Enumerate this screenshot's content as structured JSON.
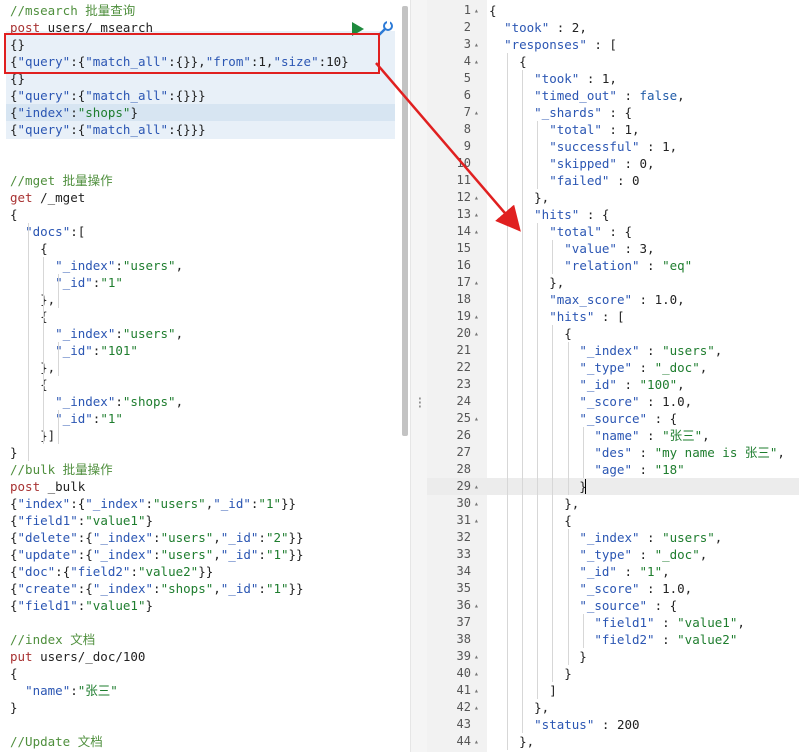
{
  "colors": {
    "comment": "#4f8f3d",
    "method": "#a83232",
    "key": "#2b56b3",
    "string": "#1e7d2e",
    "keyword": "#1f5ba8",
    "highlight": "#e8f0f8",
    "annotation_red": "#e02020",
    "run_green": "#1e8a3d"
  },
  "icons": {
    "run": "play-icon",
    "settings": "wrench-icon",
    "resize": "drag-handle-icon"
  },
  "left_lines": [
    [
      [
        "c-comment",
        "//msearch 批量查询"
      ]
    ],
    [
      [
        "c-method",
        "post"
      ],
      [
        "c-plain",
        " users/ msearch"
      ]
    ],
    [
      [
        "c-plain",
        "{}"
      ]
    ],
    [
      [
        "c-plain",
        "{"
      ],
      [
        "c-key",
        "\"query\""
      ],
      [
        "c-plain",
        ":{"
      ],
      [
        "c-key",
        "\"match_all\""
      ],
      [
        "c-plain",
        ":{}},"
      ],
      [
        "c-key",
        "\"from\""
      ],
      [
        "c-plain",
        ":1,"
      ],
      [
        "c-key",
        "\"size\""
      ],
      [
        "c-plain",
        ":10}"
      ]
    ],
    [
      [
        "c-plain",
        "{}"
      ]
    ],
    [
      [
        "c-plain",
        "{"
      ],
      [
        "c-key",
        "\"query\""
      ],
      [
        "c-plain",
        ":{"
      ],
      [
        "c-key",
        "\"match_all\""
      ],
      [
        "c-plain",
        ":{}}}"
      ]
    ],
    [
      [
        "c-plain",
        "{"
      ],
      [
        "c-key",
        "\"index\""
      ],
      [
        "c-plain",
        ":"
      ],
      [
        "c-str",
        "\"shops\""
      ],
      [
        "c-plain",
        "}"
      ]
    ],
    [
      [
        "c-plain",
        "{"
      ],
      [
        "c-key",
        "\"query\""
      ],
      [
        "c-plain",
        ":{"
      ],
      [
        "c-key",
        "\"match_all\""
      ],
      [
        "c-plain",
        ":{}}}"
      ]
    ],
    [],
    [],
    [
      [
        "c-comment",
        "//mget 批量操作"
      ]
    ],
    [
      [
        "c-method",
        "get"
      ],
      [
        "c-plain",
        " /_mget"
      ]
    ],
    [
      [
        "c-plain",
        "{"
      ]
    ],
    [
      [
        "c-plain",
        "  "
      ],
      [
        "c-key",
        "\"docs\""
      ],
      [
        "c-plain",
        ":["
      ]
    ],
    [
      [
        "c-plain",
        "    {"
      ]
    ],
    [
      [
        "c-plain",
        "      "
      ],
      [
        "c-key",
        "\"_index\""
      ],
      [
        "c-plain",
        ":"
      ],
      [
        "c-str",
        "\"users\""
      ],
      [
        "c-plain",
        ","
      ]
    ],
    [
      [
        "c-plain",
        "      "
      ],
      [
        "c-key",
        "\"_id\""
      ],
      [
        "c-plain",
        ":"
      ],
      [
        "c-str",
        "\"1\""
      ]
    ],
    [
      [
        "c-plain",
        "    },"
      ]
    ],
    [
      [
        "c-plain",
        "    {"
      ]
    ],
    [
      [
        "c-plain",
        "      "
      ],
      [
        "c-key",
        "\"_index\""
      ],
      [
        "c-plain",
        ":"
      ],
      [
        "c-str",
        "\"users\""
      ],
      [
        "c-plain",
        ","
      ]
    ],
    [
      [
        "c-plain",
        "      "
      ],
      [
        "c-key",
        "\"_id\""
      ],
      [
        "c-plain",
        ":"
      ],
      [
        "c-str",
        "\"101\""
      ]
    ],
    [
      [
        "c-plain",
        "    },"
      ]
    ],
    [
      [
        "c-plain",
        "    {"
      ]
    ],
    [
      [
        "c-plain",
        "      "
      ],
      [
        "c-key",
        "\"_index\""
      ],
      [
        "c-plain",
        ":"
      ],
      [
        "c-str",
        "\"shops\""
      ],
      [
        "c-plain",
        ","
      ]
    ],
    [
      [
        "c-plain",
        "      "
      ],
      [
        "c-key",
        "\"_id\""
      ],
      [
        "c-plain",
        ":"
      ],
      [
        "c-str",
        "\"1\""
      ]
    ],
    [
      [
        "c-plain",
        "    }]"
      ]
    ],
    [
      [
        "c-plain",
        "}"
      ]
    ],
    [
      [
        "c-comment",
        "//bulk 批量操作"
      ]
    ],
    [
      [
        "c-method",
        "post"
      ],
      [
        "c-plain",
        " _bulk"
      ]
    ],
    [
      [
        "c-plain",
        "{"
      ],
      [
        "c-key",
        "\"index\""
      ],
      [
        "c-plain",
        ":{"
      ],
      [
        "c-key",
        "\"_index\""
      ],
      [
        "c-plain",
        ":"
      ],
      [
        "c-str",
        "\"users\""
      ],
      [
        "c-plain",
        ","
      ],
      [
        "c-key",
        "\"_id\""
      ],
      [
        "c-plain",
        ":"
      ],
      [
        "c-str",
        "\"1\""
      ],
      [
        "c-plain",
        "}}"
      ]
    ],
    [
      [
        "c-plain",
        "{"
      ],
      [
        "c-key",
        "\"field1\""
      ],
      [
        "c-plain",
        ":"
      ],
      [
        "c-str",
        "\"value1\""
      ],
      [
        "c-plain",
        "}"
      ]
    ],
    [
      [
        "c-plain",
        "{"
      ],
      [
        "c-key",
        "\"delete\""
      ],
      [
        "c-plain",
        ":{"
      ],
      [
        "c-key",
        "\"_index\""
      ],
      [
        "c-plain",
        ":"
      ],
      [
        "c-str",
        "\"users\""
      ],
      [
        "c-plain",
        ","
      ],
      [
        "c-key",
        "\"_id\""
      ],
      [
        "c-plain",
        ":"
      ],
      [
        "c-str",
        "\"2\""
      ],
      [
        "c-plain",
        "}}"
      ]
    ],
    [
      [
        "c-plain",
        "{"
      ],
      [
        "c-key",
        "\"update\""
      ],
      [
        "c-plain",
        ":{"
      ],
      [
        "c-key",
        "\"_index\""
      ],
      [
        "c-plain",
        ":"
      ],
      [
        "c-str",
        "\"users\""
      ],
      [
        "c-plain",
        ","
      ],
      [
        "c-key",
        "\"_id\""
      ],
      [
        "c-plain",
        ":"
      ],
      [
        "c-str",
        "\"1\""
      ],
      [
        "c-plain",
        "}}"
      ]
    ],
    [
      [
        "c-plain",
        "{"
      ],
      [
        "c-key",
        "\"doc\""
      ],
      [
        "c-plain",
        ":{"
      ],
      [
        "c-key",
        "\"field2\""
      ],
      [
        "c-plain",
        ":"
      ],
      [
        "c-str",
        "\"value2\""
      ],
      [
        "c-plain",
        "}}"
      ]
    ],
    [
      [
        "c-plain",
        "{"
      ],
      [
        "c-key",
        "\"create\""
      ],
      [
        "c-plain",
        ":{"
      ],
      [
        "c-key",
        "\"_index\""
      ],
      [
        "c-plain",
        ":"
      ],
      [
        "c-str",
        "\"shops\""
      ],
      [
        "c-plain",
        ","
      ],
      [
        "c-key",
        "\"_id\""
      ],
      [
        "c-plain",
        ":"
      ],
      [
        "c-str",
        "\"1\""
      ],
      [
        "c-plain",
        "}}"
      ]
    ],
    [
      [
        "c-plain",
        "{"
      ],
      [
        "c-key",
        "\"field1\""
      ],
      [
        "c-plain",
        ":"
      ],
      [
        "c-str",
        "\"value1\""
      ],
      [
        "c-plain",
        "}"
      ]
    ],
    [],
    [
      [
        "c-comment",
        "//index 文档"
      ]
    ],
    [
      [
        "c-method",
        "put"
      ],
      [
        "c-plain",
        " users/_doc/100"
      ]
    ],
    [
      [
        "c-plain",
        "{"
      ]
    ],
    [
      [
        "c-plain",
        "  "
      ],
      [
        "c-key",
        "\"name\""
      ],
      [
        "c-plain",
        ":"
      ],
      [
        "c-str",
        "\"张三\""
      ]
    ],
    [
      [
        "c-plain",
        "}"
      ]
    ],
    [],
    [
      [
        "c-comment",
        "//Update 文档"
      ]
    ]
  ],
  "right_lines": [
    {
      "n": "1",
      "fold": true,
      "t": [
        [
          "c-plain",
          "{"
        ]
      ]
    },
    {
      "n": "2",
      "fold": false,
      "t": [
        [
          "c-plain",
          "  "
        ],
        [
          "c-key",
          "\"took\""
        ],
        [
          "c-plain",
          " : 2,"
        ]
      ]
    },
    {
      "n": "3",
      "fold": true,
      "t": [
        [
          "c-plain",
          "  "
        ],
        [
          "c-key",
          "\"responses\""
        ],
        [
          "c-plain",
          " : ["
        ]
      ]
    },
    {
      "n": "4",
      "fold": true,
      "t": [
        [
          "c-plain",
          "    {"
        ]
      ]
    },
    {
      "n": "5",
      "fold": false,
      "t": [
        [
          "c-plain",
          "      "
        ],
        [
          "c-key",
          "\"took\""
        ],
        [
          "c-plain",
          " : 1,"
        ]
      ]
    },
    {
      "n": "6",
      "fold": false,
      "t": [
        [
          "c-plain",
          "      "
        ],
        [
          "c-key",
          "\"timed_out\""
        ],
        [
          "c-plain",
          " : "
        ],
        [
          "c-kw",
          "false"
        ],
        [
          "c-plain",
          ","
        ]
      ]
    },
    {
      "n": "7",
      "fold": true,
      "t": [
        [
          "c-plain",
          "      "
        ],
        [
          "c-key",
          "\"_shards\""
        ],
        [
          "c-plain",
          " : {"
        ]
      ]
    },
    {
      "n": "8",
      "fold": false,
      "t": [
        [
          "c-plain",
          "        "
        ],
        [
          "c-key",
          "\"total\""
        ],
        [
          "c-plain",
          " : 1,"
        ]
      ]
    },
    {
      "n": "9",
      "fold": false,
      "t": [
        [
          "c-plain",
          "        "
        ],
        [
          "c-key",
          "\"successful\""
        ],
        [
          "c-plain",
          " : 1,"
        ]
      ]
    },
    {
      "n": "10",
      "fold": false,
      "t": [
        [
          "c-plain",
          "        "
        ],
        [
          "c-key",
          "\"skipped\""
        ],
        [
          "c-plain",
          " : 0,"
        ]
      ]
    },
    {
      "n": "11",
      "fold": false,
      "t": [
        [
          "c-plain",
          "        "
        ],
        [
          "c-key",
          "\"failed\""
        ],
        [
          "c-plain",
          " : 0"
        ]
      ]
    },
    {
      "n": "12",
      "fold": true,
      "t": [
        [
          "c-plain",
          "      },"
        ]
      ]
    },
    {
      "n": "13",
      "fold": true,
      "t": [
        [
          "c-plain",
          "      "
        ],
        [
          "c-key",
          "\"hits\""
        ],
        [
          "c-plain",
          " : {"
        ]
      ]
    },
    {
      "n": "14",
      "fold": true,
      "t": [
        [
          "c-plain",
          "        "
        ],
        [
          "c-key",
          "\"total\""
        ],
        [
          "c-plain",
          " : {"
        ]
      ]
    },
    {
      "n": "15",
      "fold": false,
      "t": [
        [
          "c-plain",
          "          "
        ],
        [
          "c-key",
          "\"value\""
        ],
        [
          "c-plain",
          " : 3,"
        ]
      ]
    },
    {
      "n": "16",
      "fold": false,
      "t": [
        [
          "c-plain",
          "          "
        ],
        [
          "c-key",
          "\"relation\""
        ],
        [
          "c-plain",
          " : "
        ],
        [
          "c-str",
          "\"eq\""
        ]
      ]
    },
    {
      "n": "17",
      "fold": true,
      "t": [
        [
          "c-plain",
          "        },"
        ]
      ]
    },
    {
      "n": "18",
      "fold": false,
      "t": [
        [
          "c-plain",
          "        "
        ],
        [
          "c-key",
          "\"max_score\""
        ],
        [
          "c-plain",
          " : 1.0,"
        ]
      ]
    },
    {
      "n": "19",
      "fold": true,
      "t": [
        [
          "c-plain",
          "        "
        ],
        [
          "c-key",
          "\"hits\""
        ],
        [
          "c-plain",
          " : ["
        ]
      ]
    },
    {
      "n": "20",
      "fold": true,
      "t": [
        [
          "c-plain",
          "          {"
        ]
      ]
    },
    {
      "n": "21",
      "fold": false,
      "t": [
        [
          "c-plain",
          "            "
        ],
        [
          "c-key",
          "\"_index\""
        ],
        [
          "c-plain",
          " : "
        ],
        [
          "c-str",
          "\"users\""
        ],
        [
          "c-plain",
          ","
        ]
      ]
    },
    {
      "n": "22",
      "fold": false,
      "t": [
        [
          "c-plain",
          "            "
        ],
        [
          "c-key",
          "\"_type\""
        ],
        [
          "c-plain",
          " : "
        ],
        [
          "c-str",
          "\"_doc\""
        ],
        [
          "c-plain",
          ","
        ]
      ]
    },
    {
      "n": "23",
      "fold": false,
      "t": [
        [
          "c-plain",
          "            "
        ],
        [
          "c-key",
          "\"_id\""
        ],
        [
          "c-plain",
          " : "
        ],
        [
          "c-str",
          "\"100\""
        ],
        [
          "c-plain",
          ","
        ]
      ]
    },
    {
      "n": "24",
      "fold": false,
      "t": [
        [
          "c-plain",
          "            "
        ],
        [
          "c-key",
          "\"_score\""
        ],
        [
          "c-plain",
          " : 1.0,"
        ]
      ]
    },
    {
      "n": "25",
      "fold": true,
      "t": [
        [
          "c-plain",
          "            "
        ],
        [
          "c-key",
          "\"_source\""
        ],
        [
          "c-plain",
          " : {"
        ]
      ]
    },
    {
      "n": "26",
      "fold": false,
      "t": [
        [
          "c-plain",
          "              "
        ],
        [
          "c-key",
          "\"name\""
        ],
        [
          "c-plain",
          " : "
        ],
        [
          "c-str",
          "\"张三\""
        ],
        [
          "c-plain",
          ","
        ]
      ]
    },
    {
      "n": "27",
      "fold": false,
      "t": [
        [
          "c-plain",
          "              "
        ],
        [
          "c-key",
          "\"des\""
        ],
        [
          "c-plain",
          " : "
        ],
        [
          "c-str",
          "\"my name is 张三\""
        ],
        [
          "c-plain",
          ","
        ]
      ]
    },
    {
      "n": "28",
      "fold": false,
      "t": [
        [
          "c-plain",
          "              "
        ],
        [
          "c-key",
          "\"age\""
        ],
        [
          "c-plain",
          " : "
        ],
        [
          "c-str",
          "\"18\""
        ]
      ]
    },
    {
      "n": "29",
      "fold": true,
      "t": [
        [
          "c-plain",
          "            }"
        ]
      ]
    },
    {
      "n": "30",
      "fold": true,
      "t": [
        [
          "c-plain",
          "          },"
        ]
      ]
    },
    {
      "n": "31",
      "fold": true,
      "t": [
        [
          "c-plain",
          "          {"
        ]
      ]
    },
    {
      "n": "32",
      "fold": false,
      "t": [
        [
          "c-plain",
          "            "
        ],
        [
          "c-key",
          "\"_index\""
        ],
        [
          "c-plain",
          " : "
        ],
        [
          "c-str",
          "\"users\""
        ],
        [
          "c-plain",
          ","
        ]
      ]
    },
    {
      "n": "33",
      "fold": false,
      "t": [
        [
          "c-plain",
          "            "
        ],
        [
          "c-key",
          "\"_type\""
        ],
        [
          "c-plain",
          " : "
        ],
        [
          "c-str",
          "\"_doc\""
        ],
        [
          "c-plain",
          ","
        ]
      ]
    },
    {
      "n": "34",
      "fold": false,
      "t": [
        [
          "c-plain",
          "            "
        ],
        [
          "c-key",
          "\"_id\""
        ],
        [
          "c-plain",
          " : "
        ],
        [
          "c-str",
          "\"1\""
        ],
        [
          "c-plain",
          ","
        ]
      ]
    },
    {
      "n": "35",
      "fold": false,
      "t": [
        [
          "c-plain",
          "            "
        ],
        [
          "c-key",
          "\"_score\""
        ],
        [
          "c-plain",
          " : 1.0,"
        ]
      ]
    },
    {
      "n": "36",
      "fold": true,
      "t": [
        [
          "c-plain",
          "            "
        ],
        [
          "c-key",
          "\"_source\""
        ],
        [
          "c-plain",
          " : {"
        ]
      ]
    },
    {
      "n": "37",
      "fold": false,
      "t": [
        [
          "c-plain",
          "              "
        ],
        [
          "c-key",
          "\"field1\""
        ],
        [
          "c-plain",
          " : "
        ],
        [
          "c-str",
          "\"value1\""
        ],
        [
          "c-plain",
          ","
        ]
      ]
    },
    {
      "n": "38",
      "fold": false,
      "t": [
        [
          "c-plain",
          "              "
        ],
        [
          "c-key",
          "\"field2\""
        ],
        [
          "c-plain",
          " : "
        ],
        [
          "c-str",
          "\"value2\""
        ]
      ]
    },
    {
      "n": "39",
      "fold": true,
      "t": [
        [
          "c-plain",
          "            }"
        ]
      ]
    },
    {
      "n": "40",
      "fold": true,
      "t": [
        [
          "c-plain",
          "          }"
        ]
      ]
    },
    {
      "n": "41",
      "fold": true,
      "t": [
        [
          "c-plain",
          "        ]"
        ]
      ]
    },
    {
      "n": "42",
      "fold": true,
      "t": [
        [
          "c-plain",
          "      },"
        ]
      ]
    },
    {
      "n": "43",
      "fold": false,
      "t": [
        [
          "c-plain",
          "      "
        ],
        [
          "c-key",
          "\"status\""
        ],
        [
          "c-plain",
          " : 200"
        ]
      ]
    },
    {
      "n": "44",
      "fold": true,
      "t": [
        [
          "c-plain",
          "    },"
        ]
      ]
    }
  ]
}
